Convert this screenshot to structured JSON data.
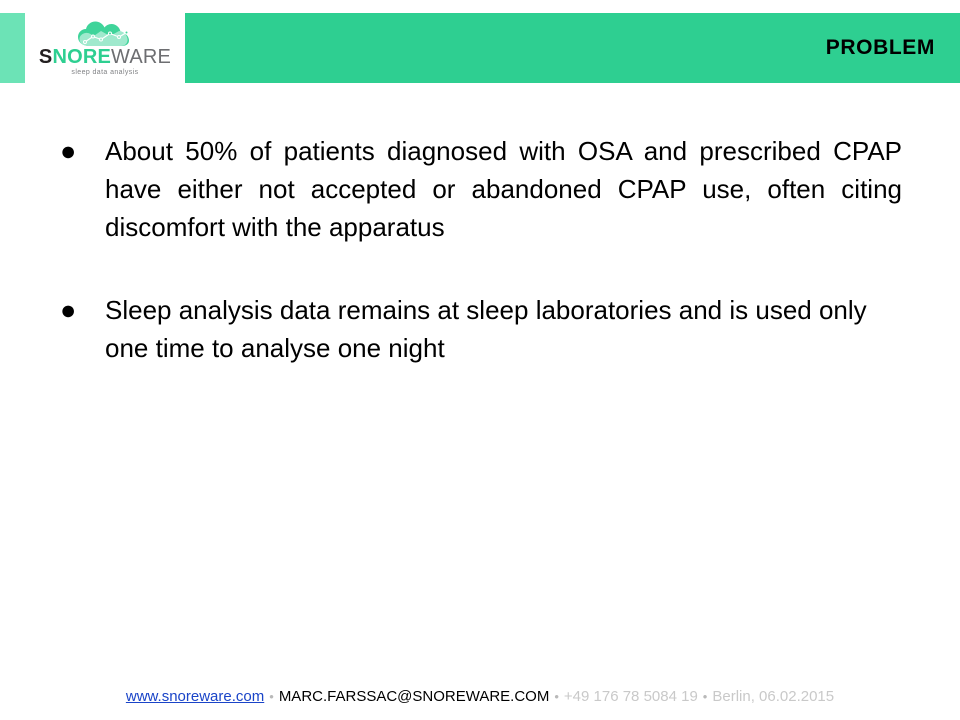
{
  "slide": {
    "title": "PROBLEM",
    "accent_color": "#2ecf91",
    "accent_light_color": "#6ce3b6"
  },
  "logo": {
    "icon": "cloud-chart-icon",
    "word_part_1": "S",
    "word_part_2": "NORE",
    "word_part_3": "WARE",
    "tagline": "sleep data analysis",
    "colors": {
      "part_1": "#231f20",
      "part_2": "#2ecf91",
      "part_3": "#6d6e71",
      "tagline": "#808285"
    }
  },
  "content": {
    "bullets": [
      {
        "marker": "●",
        "text": "About 50% of patients diagnosed with OSA and prescribed CPAP have either not accepted or abandoned CPAP use, often citing discomfort with the apparatus"
      },
      {
        "marker": "●",
        "text": "Sleep analysis data remains at sleep laboratories and is used only one time to analyse one night"
      }
    ]
  },
  "footer": {
    "website": "www.snoreware.com",
    "separator": "•",
    "email": "MARC.FARSSAC@SNOREWARE.COM",
    "phone": "+49 176 78 5084 19",
    "place_date": "Berlin, 06.02.2015",
    "link_color": "#1a44c8",
    "muted_color": "#c9c9c9"
  }
}
